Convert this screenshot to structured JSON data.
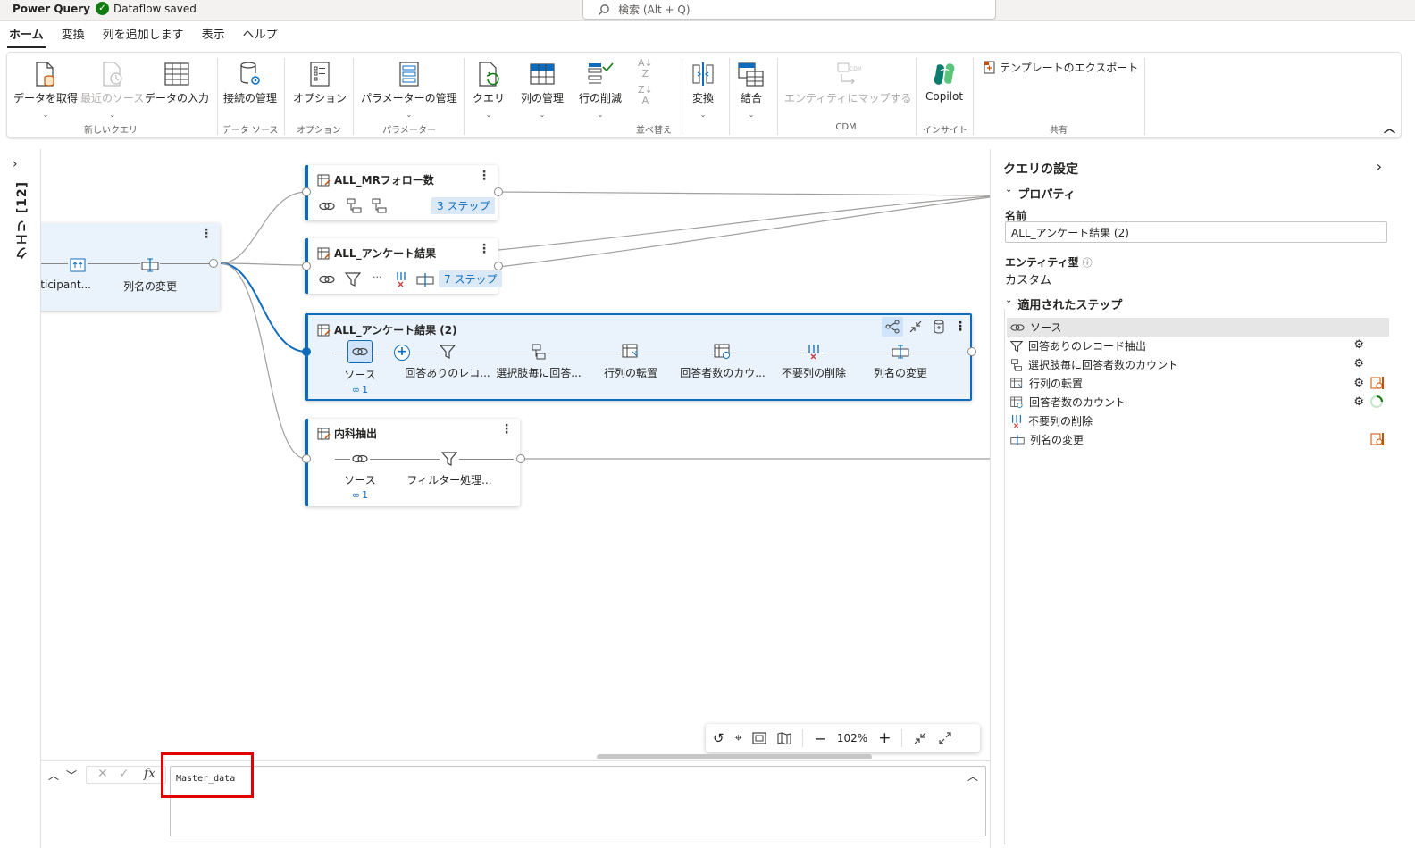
{
  "app": {
    "title": "Power Query",
    "save_status": "Dataflow saved",
    "search_placeholder": "検索 (Alt + Q)"
  },
  "tabs": [
    {
      "label": "ホーム",
      "active": true
    },
    {
      "label": "変換"
    },
    {
      "label": "列を追加します"
    },
    {
      "label": "表示"
    },
    {
      "label": "ヘルプ"
    }
  ],
  "ribbon": {
    "get_data": "データを取得",
    "recent_sources": "最近のソース",
    "enter_data": "データの入力",
    "manage_connections": "接続の管理",
    "options": "オプション",
    "manage_parameters": "パラメーターの管理",
    "query": "クエリ",
    "manage_columns": "列の管理",
    "reduce_rows": "行の削減",
    "transform": "変換",
    "combine": "結合",
    "map_to_entity": "エンティティにマップする",
    "copilot": "Copilot",
    "export_template": "テンプレートのエクスポート",
    "groups": {
      "new_query": "新しいクエリ",
      "data_source": "データ ソース",
      "options": "オプション",
      "parameters": "パラメーター",
      "sort": "並べ替え",
      "cdm": "CDM",
      "insight": "インサイト",
      "share": "共有"
    }
  },
  "queries_panel": {
    "label": "クエリ [12]"
  },
  "diagram": {
    "left_card": {
      "step1": "_participant...",
      "step2": "列名の変更"
    },
    "cards": [
      {
        "title": "ALL_MRフォロー数",
        "steps_badge": "3 ステップ"
      },
      {
        "title": "ALL_アンケート結果",
        "steps_badge": "7 ステップ",
        "ellipsis": "···"
      },
      {
        "title": "ALL_アンケート結果 (2)",
        "source_count": "1",
        "steps": [
          "ソース",
          "回答ありのレコ...",
          "選択肢毎に回答...",
          "行列の転置",
          "回答者数のカウ...",
          "不要列の削除",
          "列名の変更"
        ]
      },
      {
        "title": "内科抽出",
        "source_count": "1",
        "steps": [
          "ソース",
          "フィルター処理..."
        ]
      }
    ],
    "zoom": "102%"
  },
  "formula": {
    "value": "Master_data",
    "fx": "fx"
  },
  "settings": {
    "title": "クエリの設定",
    "properties": "プロパティ",
    "name_label": "名前",
    "name_value": "ALL_アンケート結果 (2)",
    "entity_label": "エンティティ型",
    "entity_value": "カスタム",
    "applied_steps": "適用されたステップ",
    "steps": [
      "ソース",
      "回答ありのレコード抽出",
      "選択肢毎に回答者数のカウント",
      "行列の転置",
      "回答者数のカウント",
      "不要列の削除",
      "列名の変更"
    ]
  }
}
